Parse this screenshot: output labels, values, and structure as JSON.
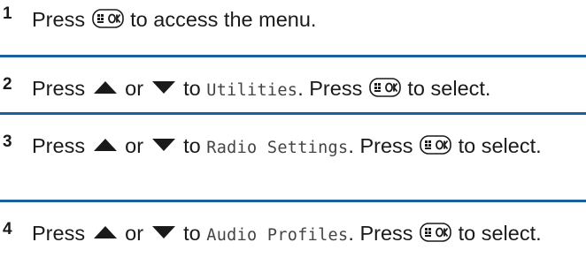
{
  "steps": [
    {
      "number": "1",
      "t1": "Press",
      "t2": "to access the menu."
    },
    {
      "number": "2",
      "t1": "Press",
      "t2": "or",
      "t3": "to",
      "menu": "Utilities",
      "t4": ". Press",
      "t5": "to select."
    },
    {
      "number": "3",
      "t1": "Press",
      "t2": "or",
      "t3": "to",
      "menu": "Radio Settings",
      "t4": ". Press",
      "t5": "to select."
    },
    {
      "number": "4",
      "t1": "Press",
      "t2": "or",
      "t3": "to",
      "menu": "Audio Profiles",
      "t4": ". Press",
      "t5": "to select."
    }
  ],
  "icons": {
    "ok_button": "menu-ok-button-icon",
    "up": "up-arrow-icon",
    "down": "down-arrow-icon"
  },
  "colors": {
    "divider": "#1a5fa0",
    "text": "#1a1a1a"
  }
}
